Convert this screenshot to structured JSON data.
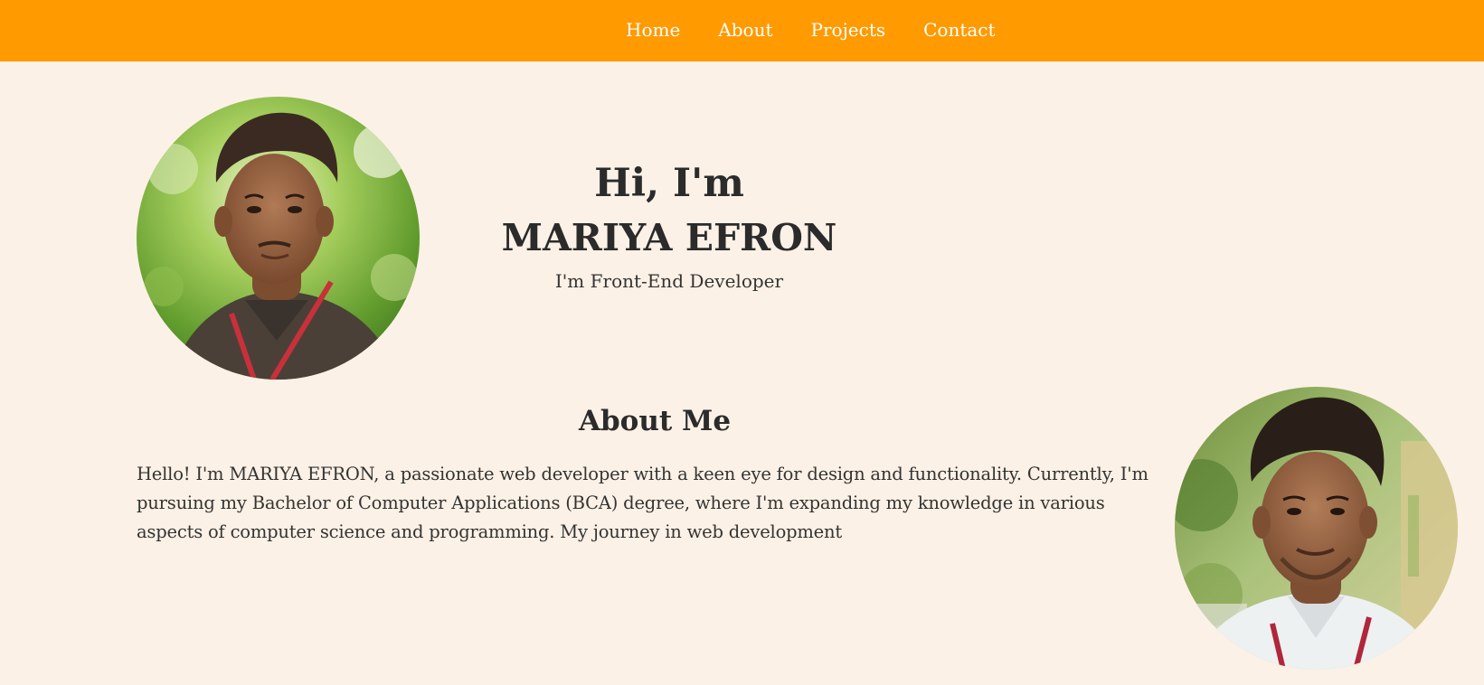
{
  "nav": {
    "links": [
      "Home",
      "About",
      "Projects",
      "Contact"
    ]
  },
  "hero": {
    "greeting": "Hi, I'm",
    "name": "MARIYA EFRON",
    "role": "I'm Front-End Developer"
  },
  "about": {
    "title": "About Me",
    "text": "Hello! I'm MARIYA EFRON, a passionate web developer with a keen eye for design and functionality. Currently, I'm pursuing my Bachelor of Computer Applications (BCA) degree, where I'm expanding my knowledge in various aspects of computer science and programming. My journey in web development"
  },
  "colors": {
    "nav_background": "#ff9a00",
    "page_background": "#fcf1e6",
    "text": "#2b2b2b",
    "nav_text": "#ffffff"
  }
}
